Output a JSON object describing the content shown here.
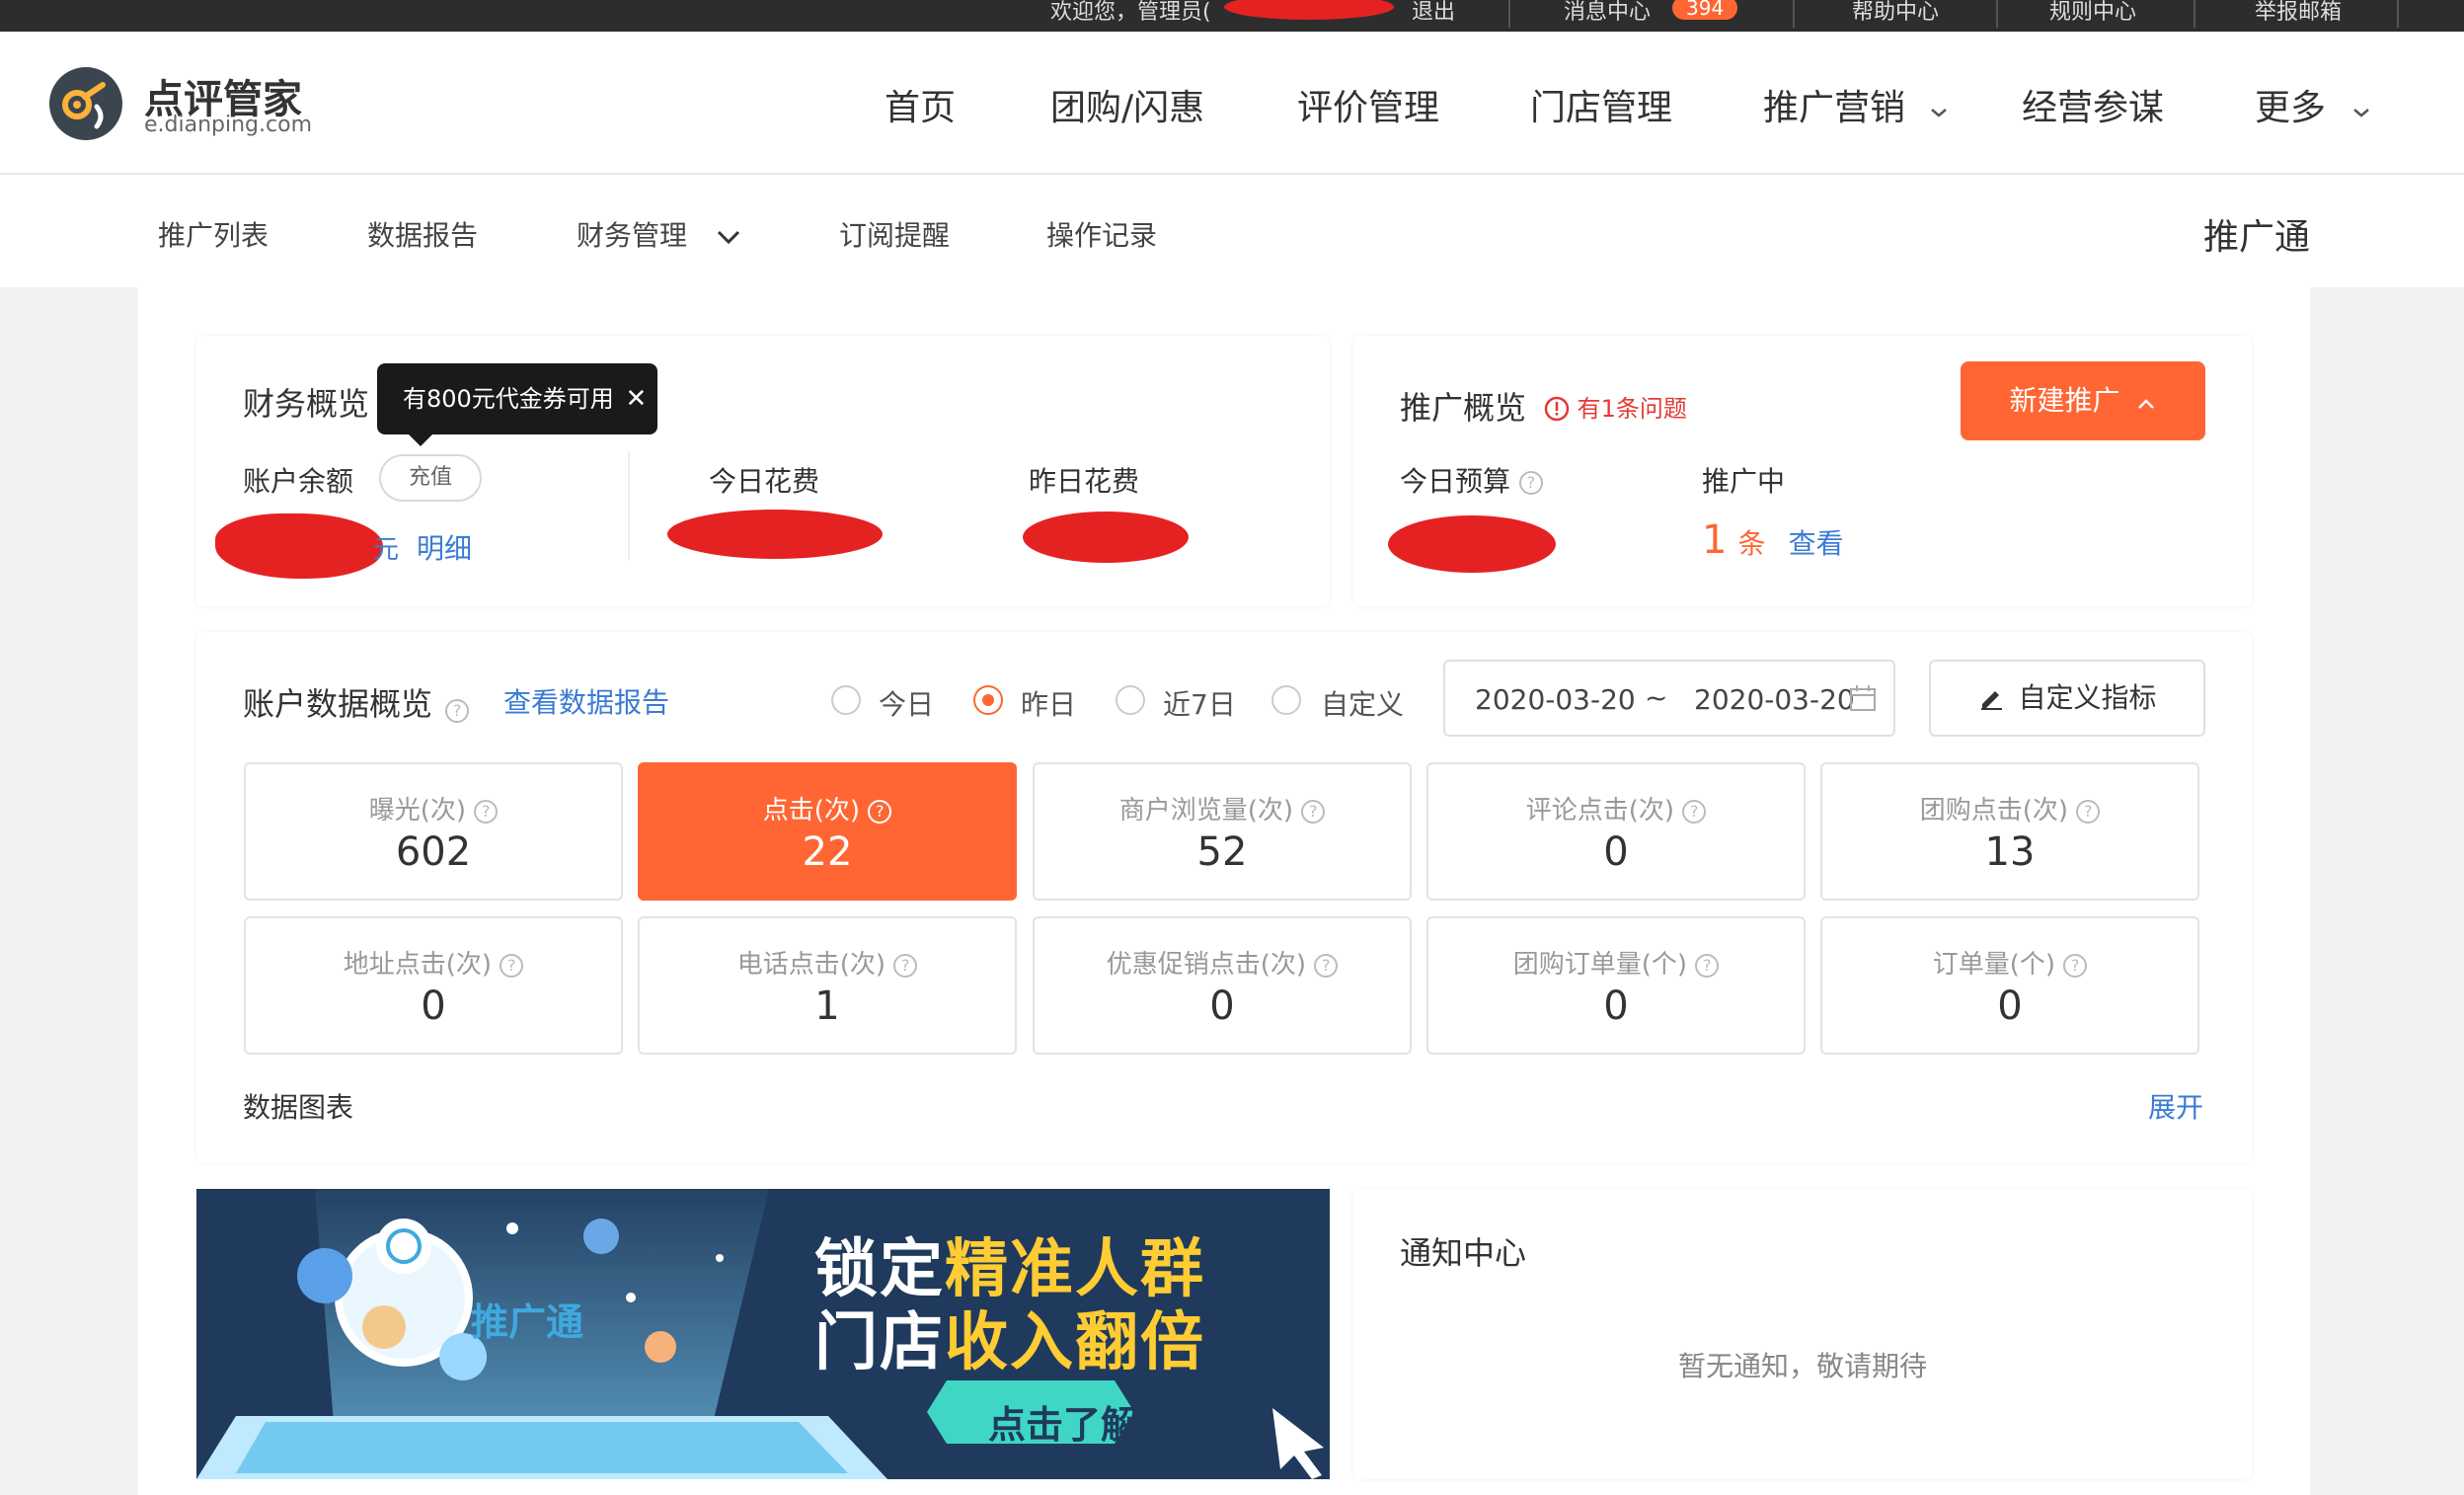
{
  "topbar": {
    "welcome": "欢迎您，管理员(",
    "logout": "退出",
    "messages": "消息中心",
    "message_count": "394",
    "help": "帮助中心",
    "rules": "规则中心",
    "report": "举报邮箱"
  },
  "header": {
    "logo_title": "点评管家",
    "logo_sub": "e.dianping.com",
    "nav": [
      "首页",
      "团购/闪惠",
      "评价管理",
      "门店管理",
      "推广营销",
      "经营参谋",
      "更多"
    ]
  },
  "subnav": {
    "items": [
      "推广列表",
      "数据报告",
      "财务管理",
      "订阅提醒",
      "操作记录"
    ],
    "product": "推广通"
  },
  "finance": {
    "title": "财务概览",
    "tooltip": "有800元代金券可用",
    "balance_label": "账户余额",
    "recharge": "充值",
    "unit": "元",
    "detail": "明细",
    "today_cost": "今日花费",
    "yesterday_cost": "昨日花费"
  },
  "promo": {
    "title": "推广概览",
    "issue": "有1条问题",
    "new_button": "新建推广",
    "budget_label": "今日预算",
    "running_label": "推广中",
    "running_count": "1",
    "count_unit": "条",
    "view": "查看"
  },
  "account": {
    "title": "账户数据概览",
    "report_link": "查看数据报告",
    "ranges": [
      "今日",
      "昨日",
      "近7日",
      "自定义"
    ],
    "selected_range": "昨日",
    "date_from": "2020-03-20",
    "date_sep": "~",
    "date_to": "2020-03-20",
    "custom_button": "自定义指标",
    "metrics_row1": [
      {
        "label": "曝光(次)",
        "value": "602"
      },
      {
        "label": "点击(次)",
        "value": "22"
      },
      {
        "label": "商户浏览量(次)",
        "value": "52"
      },
      {
        "label": "评论点击(次)",
        "value": "0"
      },
      {
        "label": "团购点击(次)",
        "value": "13"
      }
    ],
    "metrics_row2": [
      {
        "label": "地址点击(次)",
        "value": "0"
      },
      {
        "label": "电话点击(次)",
        "value": "1"
      },
      {
        "label": "优惠促销点击(次)",
        "value": "0"
      },
      {
        "label": "团购订单量(个)",
        "value": "0"
      },
      {
        "label": "订单量(个)",
        "value": "0"
      }
    ],
    "chart_label": "数据图表",
    "expand": "展开"
  },
  "banner": {
    "brand": "推广通",
    "line1_a": "锁定",
    "line1_b": "精准人群",
    "line2_a": "门店",
    "line2_b": "收入翻倍",
    "cta": "点击了解详情"
  },
  "notice": {
    "title": "通知中心",
    "empty": "暂无通知，敬请期待"
  },
  "colors": {
    "accent": "#ff6633",
    "link": "#3a7bd5",
    "warning": "#e53935"
  }
}
